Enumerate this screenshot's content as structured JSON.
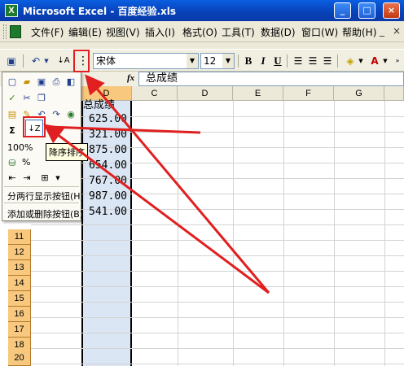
{
  "window": {
    "app_icon": "excel-icon",
    "title": "Microsoft Excel - 百度经验.xls",
    "buttons": [
      "_",
      "□",
      "×"
    ]
  },
  "menu": {
    "items": [
      "文件(F)",
      "编辑(E)",
      "视图(V)",
      "插入(I)",
      "格式(O)",
      "工具(T)",
      "数据(D)",
      "窗口(W)",
      "帮助(H)"
    ],
    "mdi_buttons": [
      "_",
      "×"
    ]
  },
  "toolbar": {
    "font_name": "宋体",
    "font_size": "12",
    "bold": "B",
    "italic": "I",
    "underline": "U",
    "font_color_label": "A"
  },
  "formula_bar": {
    "fx_label": "fx",
    "content": "总成绩"
  },
  "grid": {
    "columns": [
      "D",
      "C",
      "D",
      "E",
      "F",
      "G"
    ],
    "header_text": "总成绩",
    "values": [
      "625.00",
      "321.00",
      "875.00",
      "654.00",
      "767.00",
      "987.00",
      "541.00"
    ],
    "row_numbers": [
      "11",
      "12",
      "13",
      "14",
      "15",
      "16",
      "17",
      "18",
      "19",
      "20"
    ]
  },
  "popup": {
    "zoom": "100%",
    "percent": "%",
    "tooltip": "降序排序",
    "split_rows": "分两行显示按钮(H)",
    "add_remove": "添加或删除按钮(B)"
  },
  "colors": {
    "annotation_red": "#e02020",
    "selected_header": "#f7c87d",
    "selection_fill": "#dbe6f5"
  }
}
